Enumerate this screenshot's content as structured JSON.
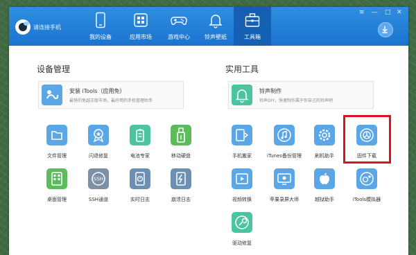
{
  "header": {
    "connect_text": "请连接手机",
    "nav": [
      {
        "label": "我的设备",
        "icon": "phone-icon"
      },
      {
        "label": "应用市场",
        "icon": "app-market-icon"
      },
      {
        "label": "游戏中心",
        "icon": "gamepad-icon"
      },
      {
        "label": "铃声壁纸",
        "icon": "bell-icon"
      },
      {
        "label": "工具箱",
        "icon": "toolbox-icon",
        "active": true
      }
    ]
  },
  "left": {
    "title": "设备管理",
    "banner": {
      "title": "安装 iTools（应用免）",
      "desc": "最快的免越正版市场，最好用的手机管理助手"
    },
    "tools": [
      {
        "label": "文件管理",
        "icon": "folder-icon",
        "color": "#5aa6e6"
      },
      {
        "label": "闪退修复",
        "icon": "badge-icon",
        "color": "#5aa6e6"
      },
      {
        "label": "电池专家",
        "icon": "battery-icon",
        "color": "#4cc3a1"
      },
      {
        "label": "移动硬盘",
        "icon": "usb-drive-icon",
        "color": "#5dbb5d"
      },
      {
        "label": "桌面管理",
        "icon": "grid-icon",
        "color": "#5dbb5d"
      },
      {
        "label": "SSH通道",
        "icon": "ssh-icon",
        "color": "#7c8fa6"
      },
      {
        "label": "实时日志",
        "icon": "log-icon",
        "color": "#6d8fb3"
      },
      {
        "label": "崩溃日志",
        "icon": "crash-log-icon",
        "color": "#6d8fb3"
      }
    ]
  },
  "right": {
    "title": "实用工具",
    "banner": {
      "title": "铃声制作",
      "desc": "铃声DIY，快速制作属于你自己的铃声吧"
    },
    "tools": [
      {
        "label": "手机搬家",
        "icon": "phone-transfer-icon",
        "color": "#5aa6e6"
      },
      {
        "label": "iTunes备份管理",
        "icon": "music-icon",
        "color": "#5aa6e6"
      },
      {
        "label": "刷机助手",
        "icon": "gear-icon",
        "color": "#5aa6e6"
      },
      {
        "label": "固件下载",
        "icon": "firmware-icon",
        "color": "#5aa6e6"
      },
      {
        "label": "视频转换",
        "icon": "video-icon",
        "color": "#5aa6e6"
      },
      {
        "label": "苹果录屏大师",
        "icon": "screen-record-icon",
        "color": "#5aa6e6"
      },
      {
        "label": "越狱助手",
        "icon": "apple-icon",
        "color": "#5aa6e6"
      },
      {
        "label": "iTools模拟器",
        "icon": "simulator-icon",
        "color": "#5aa6e6"
      },
      {
        "label": "驱动修复",
        "icon": "wrench-icon",
        "color": "#4cc3a1"
      }
    ]
  },
  "colors": {
    "topbar": "#1b73cf",
    "active_tab": "#1460b4",
    "highlight": "#d8141c"
  }
}
